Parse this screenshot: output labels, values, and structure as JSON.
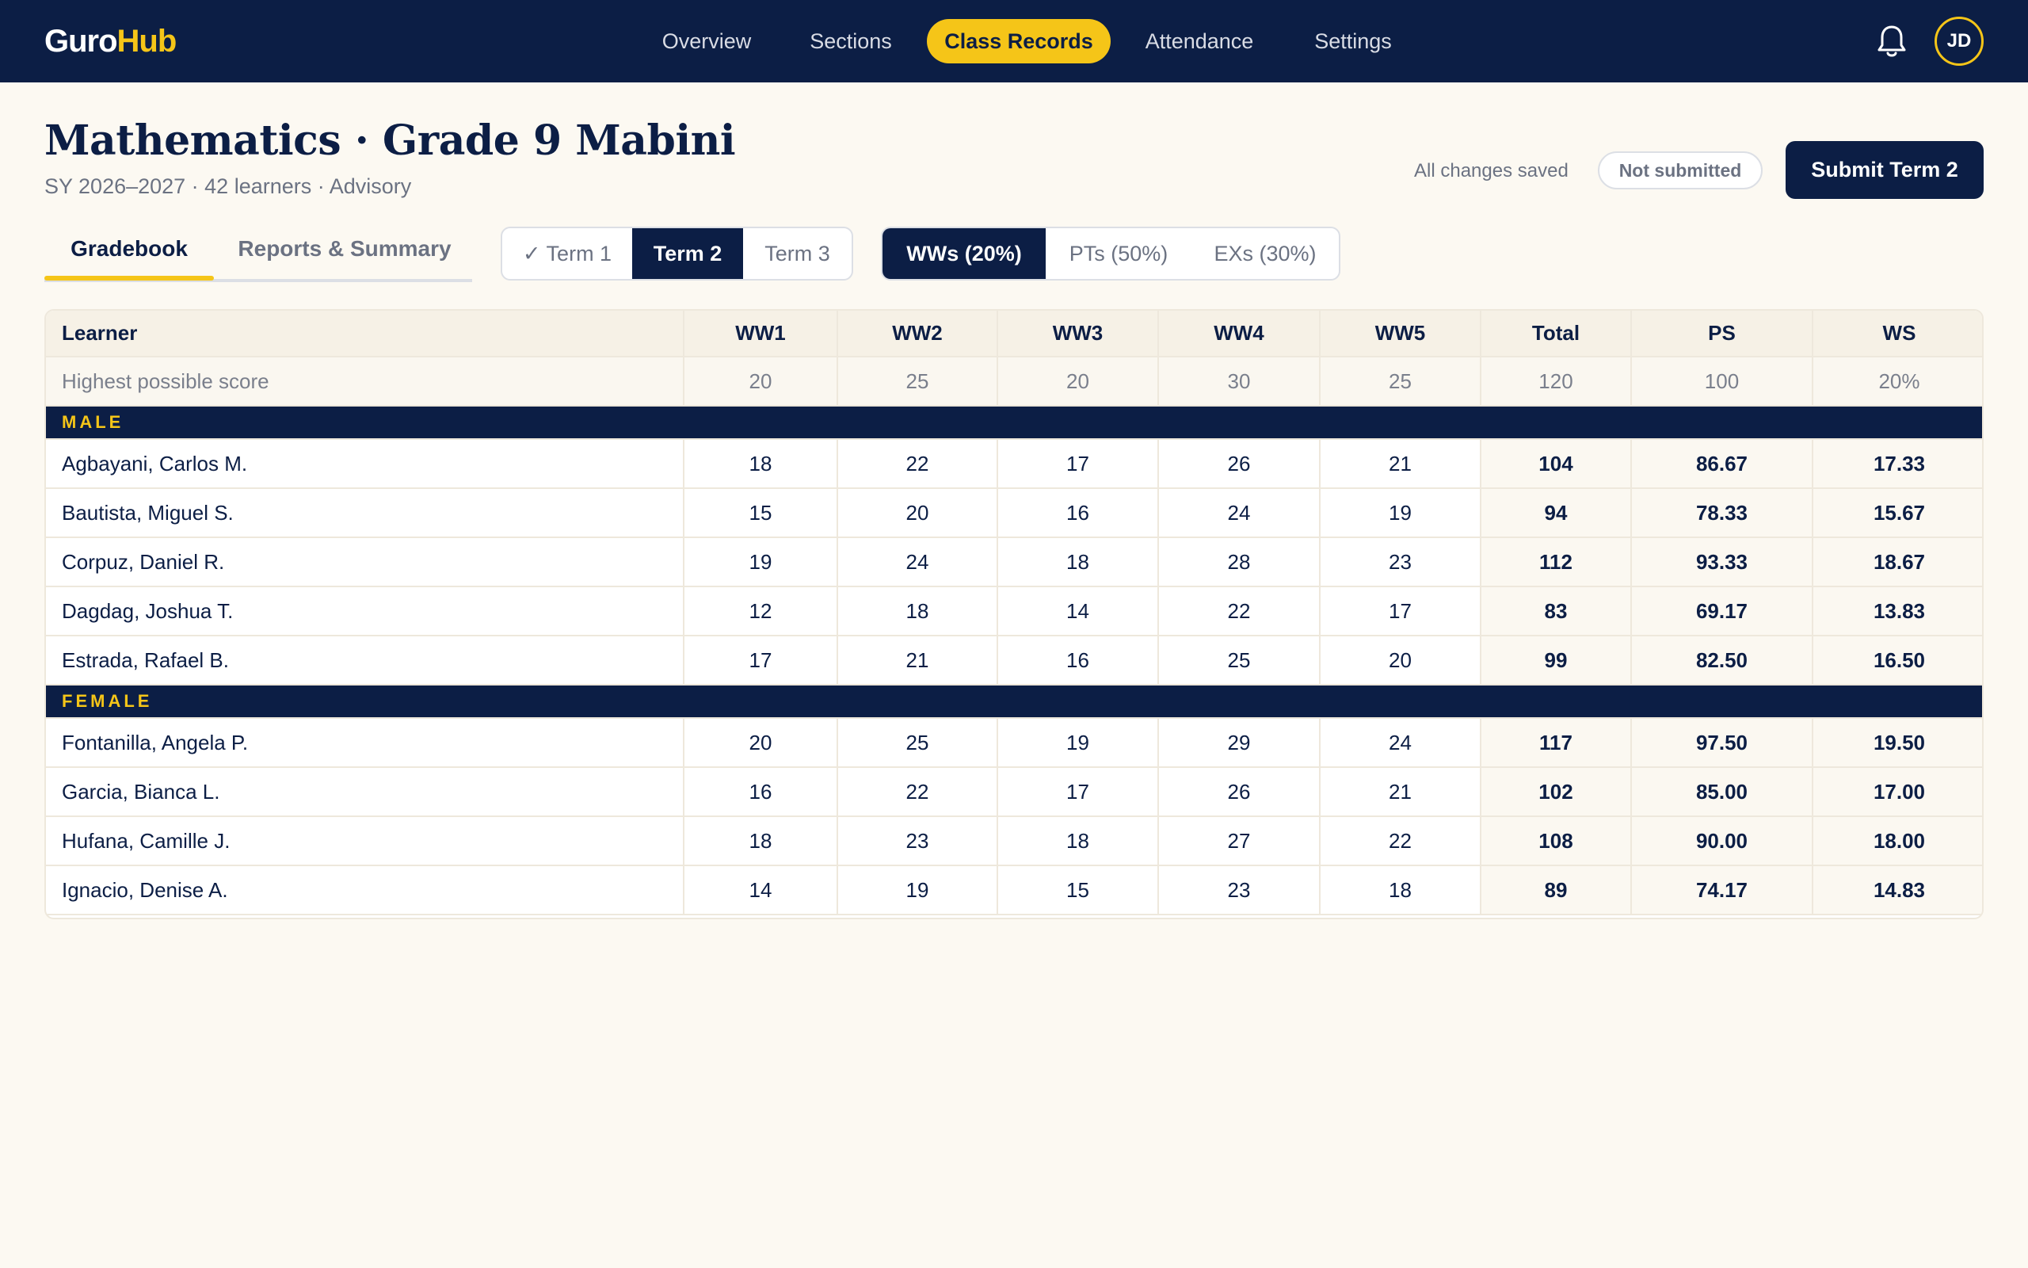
{
  "app": {
    "logo_a": "Guro",
    "logo_b": "Hub",
    "nav": [
      "Overview",
      "Sections",
      "Class Records",
      "Attendance",
      "Settings"
    ],
    "nav_active": "Class Records",
    "avatar_initials": "JD"
  },
  "header": {
    "title": "Mathematics · Grade 9 Mabini",
    "subtitle": "SY 2026–2027 · 42 learners · Advisory",
    "save_status": "All changes saved",
    "submission_badge": "Not submitted",
    "submit_label": "Submit Term 2"
  },
  "tabs": {
    "items": [
      "Gradebook",
      "Reports & Summary"
    ],
    "active": "Gradebook"
  },
  "terms": {
    "items": [
      "✓ Term 1",
      "Term 2",
      "Term 3"
    ],
    "active": "Term 2"
  },
  "components": {
    "items": [
      "WWs (20%)",
      "PTs (50%)",
      "EXs (30%)"
    ],
    "active": "WWs (20%)"
  },
  "table": {
    "columns": [
      "Learner",
      "WW1",
      "WW2",
      "WW3",
      "WW4",
      "WW5",
      "Total",
      "PS",
      "WS"
    ],
    "hps_label": "Highest possible score",
    "hps": [
      "20",
      "25",
      "20",
      "30",
      "25",
      "120",
      "100",
      "20%"
    ],
    "groups": [
      {
        "label": "MALE",
        "rows": [
          {
            "name": "Agbayani, Carlos M.",
            "scores": [
              "18",
              "22",
              "17",
              "26",
              "21"
            ],
            "total": "104",
            "ps": "86.67",
            "ws": "17.33"
          },
          {
            "name": "Bautista, Miguel S.",
            "scores": [
              "15",
              "20",
              "16",
              "24",
              "19"
            ],
            "total": "94",
            "ps": "78.33",
            "ws": "15.67"
          },
          {
            "name": "Corpuz, Daniel R.",
            "scores": [
              "19",
              "24",
              "18",
              "28",
              "23"
            ],
            "total": "112",
            "ps": "93.33",
            "ws": "18.67"
          },
          {
            "name": "Dagdag, Joshua T.",
            "scores": [
              "12",
              "18",
              "14",
              "22",
              "17"
            ],
            "total": "83",
            "ps": "69.17",
            "ws": "13.83"
          },
          {
            "name": "Estrada, Rafael B.",
            "scores": [
              "17",
              "21",
              "16",
              "25",
              "20"
            ],
            "total": "99",
            "ps": "82.50",
            "ws": "16.50"
          }
        ]
      },
      {
        "label": "FEMALE",
        "rows": [
          {
            "name": "Fontanilla, Angela P.",
            "scores": [
              "20",
              "25",
              "19",
              "29",
              "24"
            ],
            "total": "117",
            "ps": "97.50",
            "ws": "19.50"
          },
          {
            "name": "Garcia, Bianca L.",
            "scores": [
              "16",
              "22",
              "17",
              "26",
              "21"
            ],
            "total": "102",
            "ps": "85.00",
            "ws": "17.00"
          },
          {
            "name": "Hufana, Camille J.",
            "scores": [
              "18",
              "23",
              "18",
              "27",
              "22"
            ],
            "total": "108",
            "ps": "90.00",
            "ws": "18.00"
          },
          {
            "name": "Ignacio, Denise A.",
            "scores": [
              "14",
              "19",
              "15",
              "23",
              "18"
            ],
            "total": "89",
            "ps": "74.17",
            "ws": "14.83"
          }
        ]
      }
    ]
  },
  "colors": {
    "navy": "#0c1e45",
    "accent": "#f5c518",
    "background": "#fcf9f2"
  },
  "icons": {
    "notifications": "bell-icon"
  }
}
